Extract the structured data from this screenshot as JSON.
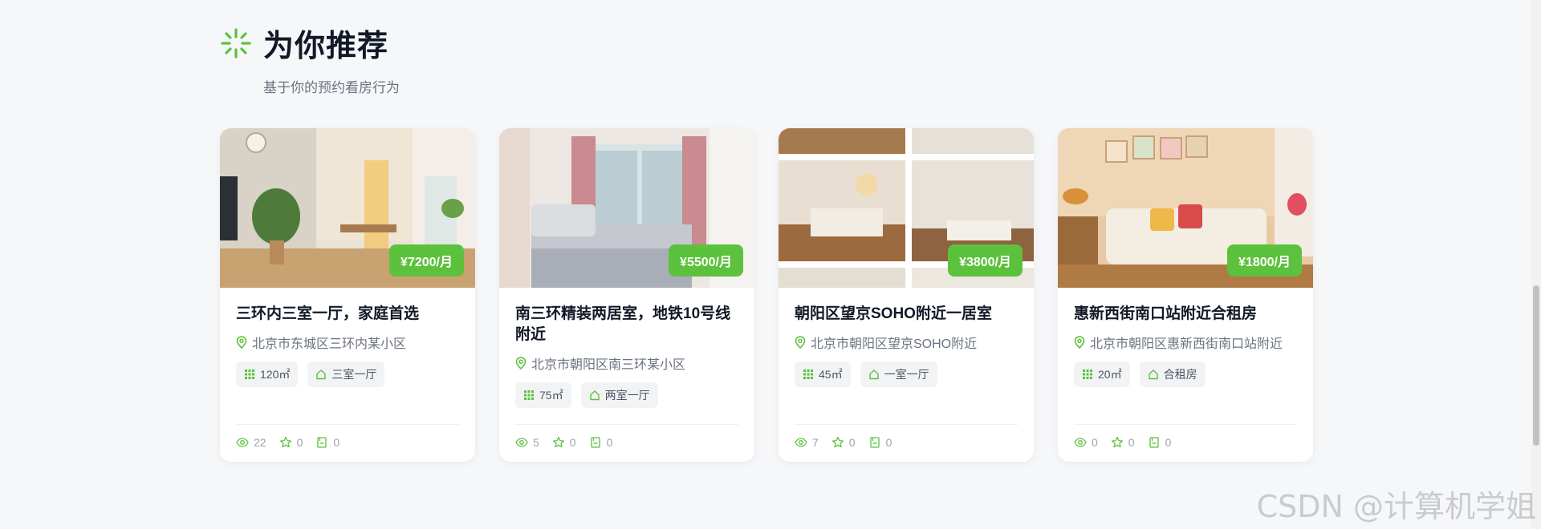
{
  "section": {
    "title": "为你推荐",
    "subtitle": "基于你的预约看房行为",
    "icon": "sparkle-icon",
    "accent_color": "#5cc13c"
  },
  "cards": [
    {
      "price": "¥7200/月",
      "title": "三环内三室一厅，家庭首选",
      "address": "北京市东城区三环内某小区",
      "area": "120㎡",
      "layout": "三室一厅",
      "views": "22",
      "favorites": "0",
      "bookings": "0"
    },
    {
      "price": "¥5500/月",
      "title": "南三环精装两居室，地铁10号线附近",
      "address": "北京市朝阳区南三环某小区",
      "area": "75㎡",
      "layout": "两室一厅",
      "views": "5",
      "favorites": "0",
      "bookings": "0"
    },
    {
      "price": "¥3800/月",
      "title": "朝阳区望京SOHO附近一居室",
      "address": "北京市朝阳区望京SOHO附近",
      "area": "45㎡",
      "layout": "一室一厅",
      "views": "7",
      "favorites": "0",
      "bookings": "0"
    },
    {
      "price": "¥1800/月",
      "title": "惠新西街南口站附近合租房",
      "address": "北京市朝阳区惠新西街南口站附近",
      "area": "20㎡",
      "layout": "合租房",
      "views": "0",
      "favorites": "0",
      "bookings": "0"
    }
  ],
  "watermark": "CSDN @计算机学姐"
}
